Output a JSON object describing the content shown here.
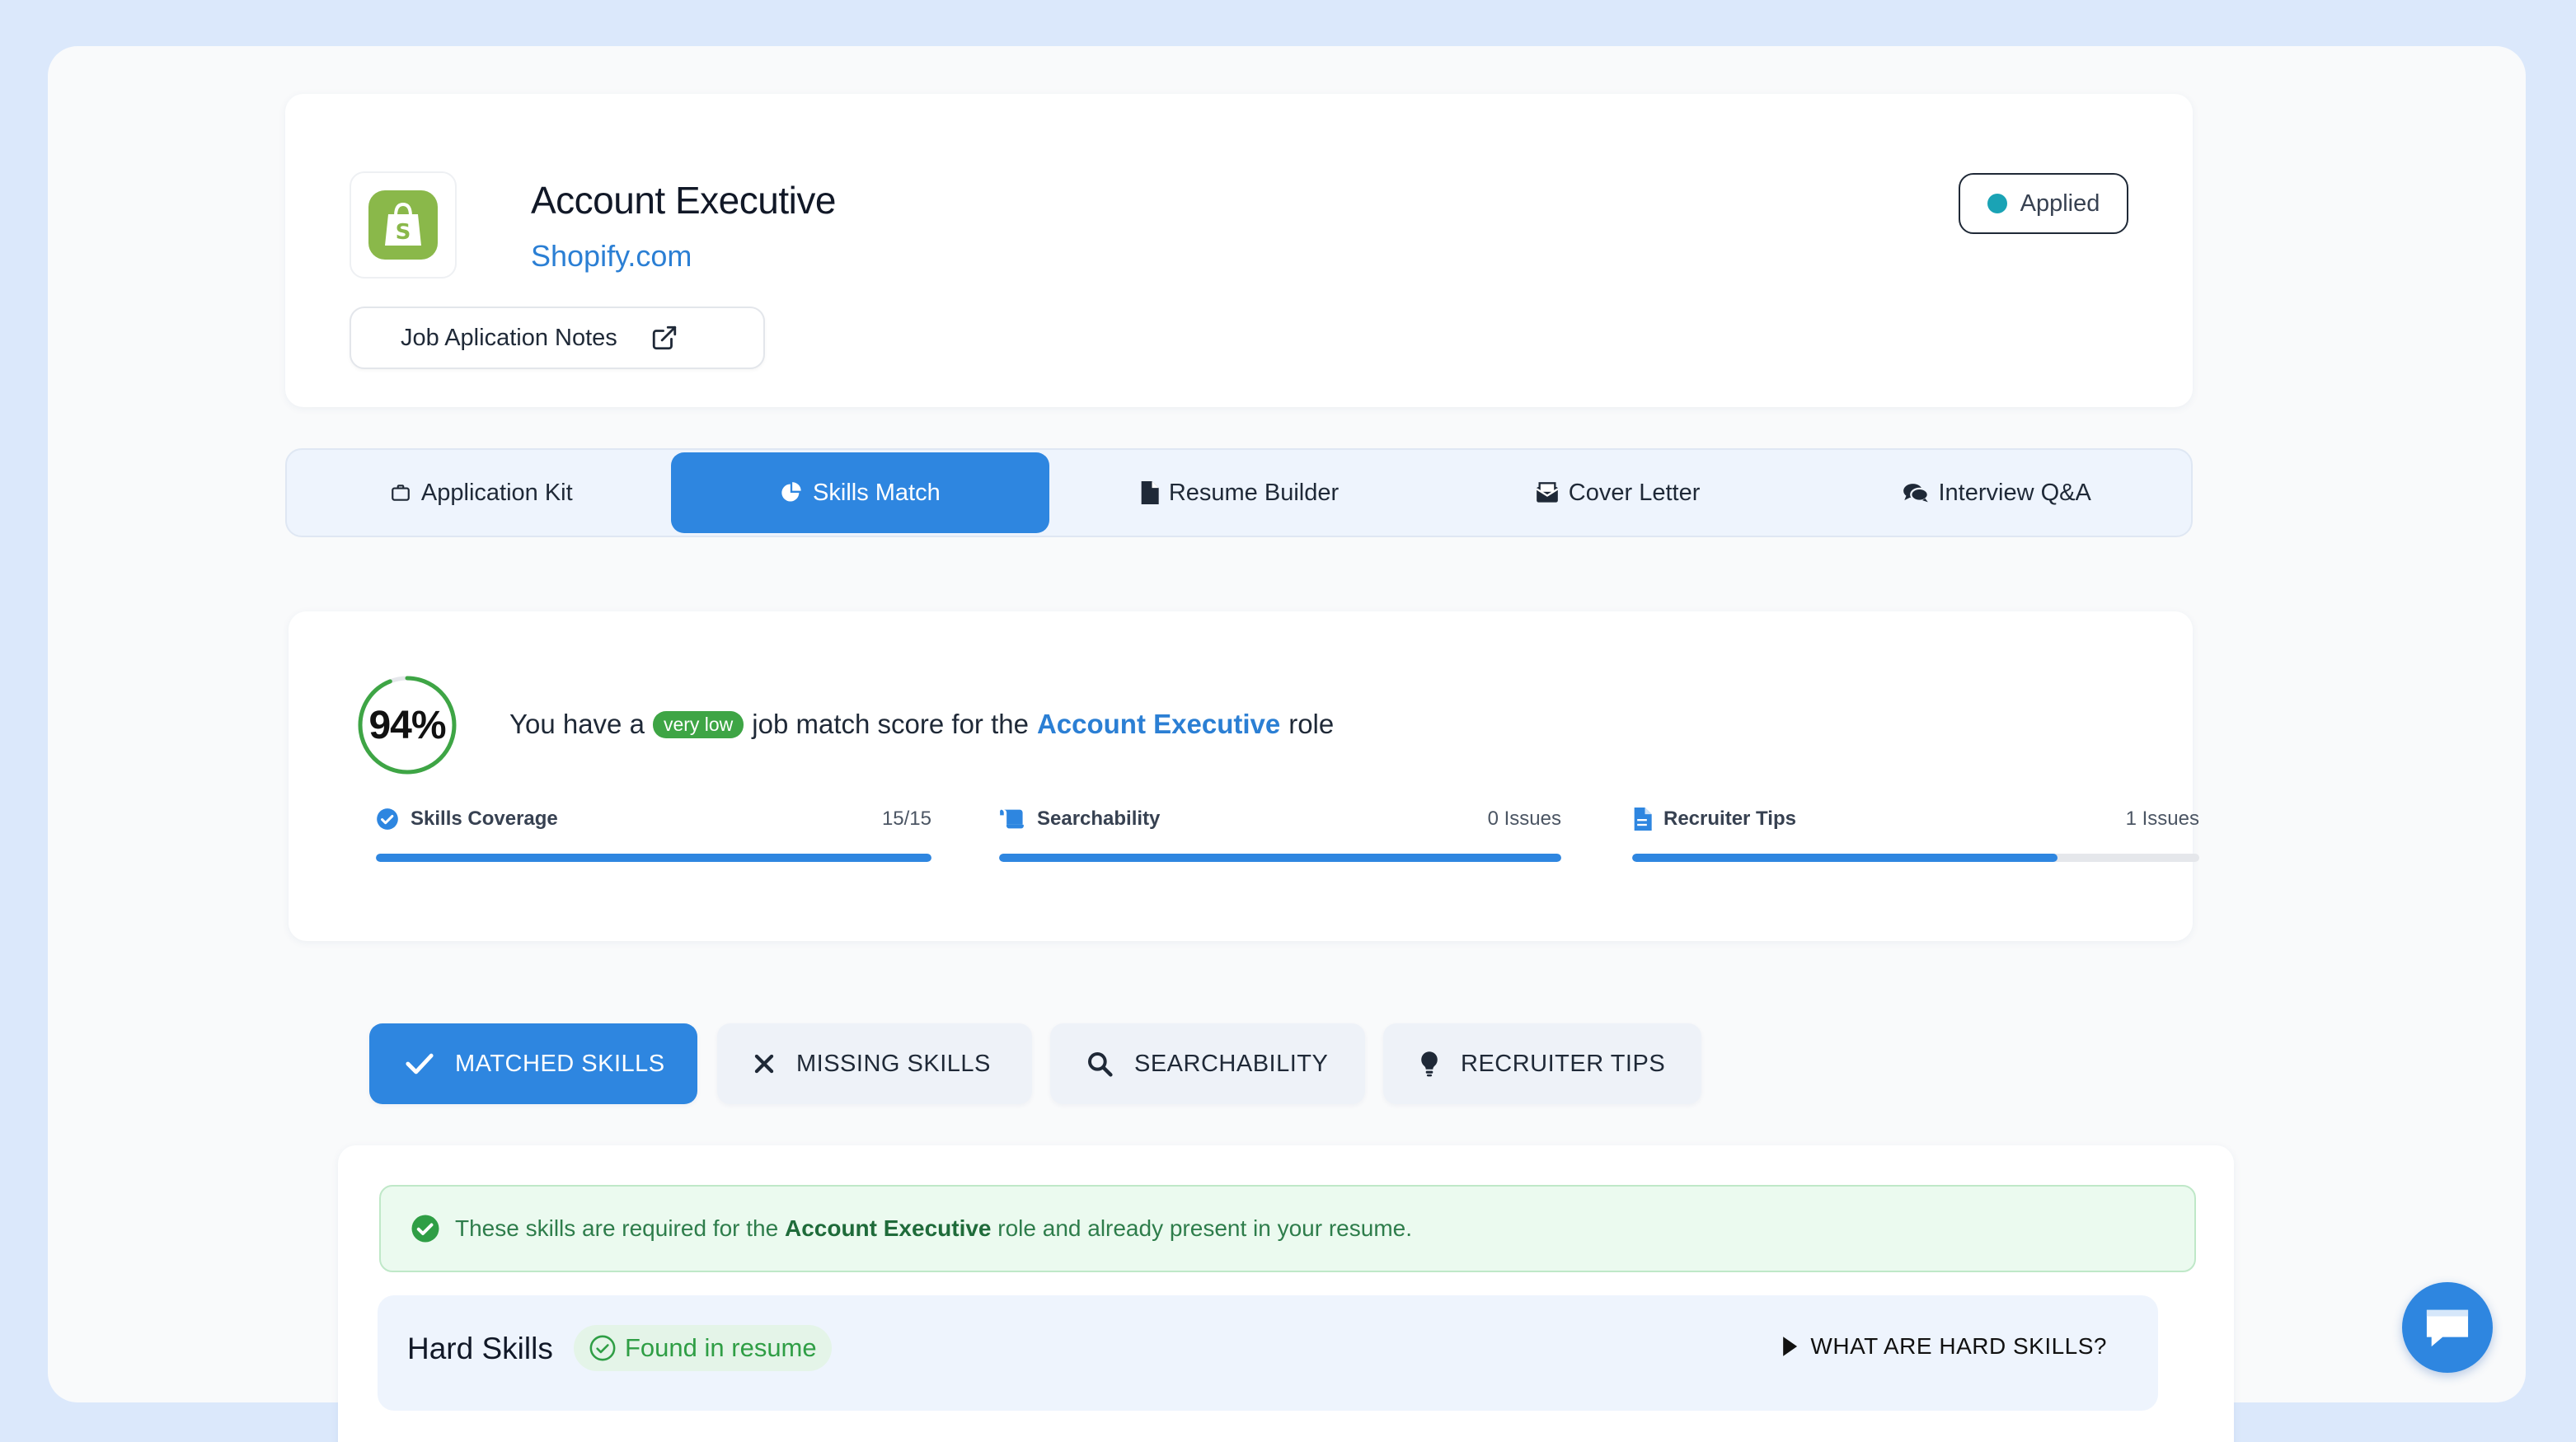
{
  "job": {
    "title": "Account Executive",
    "company": "Shopify.com",
    "notes_label": "Job Aplication Notes",
    "status": "Applied"
  },
  "tabs": [
    {
      "label": "Application Kit",
      "icon": "briefcase-icon"
    },
    {
      "label": "Skills Match",
      "icon": "pie-chart-icon",
      "active": true
    },
    {
      "label": "Resume Builder",
      "icon": "file-icon"
    },
    {
      "label": "Cover Letter",
      "icon": "envelope-icon"
    },
    {
      "label": "Interview Q&A",
      "icon": "comments-icon"
    }
  ],
  "score": {
    "percent_label": "94%",
    "percent": 94,
    "sentence_prefix": "You have a",
    "level_badge": "very low",
    "sentence_middle": "job match score for the",
    "role": "Account Executive",
    "sentence_suffix": "role"
  },
  "metrics": [
    {
      "label": "Skills Coverage",
      "value": "15/15",
      "progress": 1.0
    },
    {
      "label": "Searchability",
      "value": "0 Issues",
      "progress": 1.0
    },
    {
      "label": "Recruiter Tips",
      "value": "1 Issues",
      "progress": 0.75
    }
  ],
  "skill_tabs": [
    {
      "label": "MATCHED SKILLS",
      "icon": "check-icon",
      "active": true
    },
    {
      "label": "MISSING SKILLS",
      "icon": "x-icon"
    },
    {
      "label": "SEARCHABILITY",
      "icon": "search-icon"
    },
    {
      "label": "RECRUITER TIPS",
      "icon": "lightbulb-icon"
    }
  ],
  "banner": {
    "prefix": "These skills are required for the",
    "role": "Account Executive",
    "suffix": "role and already present in your resume."
  },
  "hard_skills": {
    "title": "Hard Skills",
    "found_label": "Found in resume",
    "link_label": "WHAT ARE HARD SKILLS?"
  },
  "colors": {
    "accent": "#2e86e0",
    "success": "#3ea545",
    "status_dot": "#1aa3b5",
    "link": "#2b7fd4"
  }
}
